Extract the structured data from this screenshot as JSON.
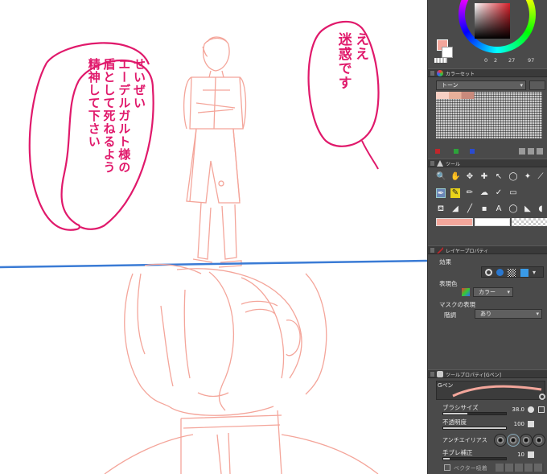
{
  "colors": {
    "accent_pink": "#e0196b",
    "sketch_pink": "#f4a59a",
    "guide_blue": "#3a7bd5",
    "main_color": "#f3a69b",
    "panel_bg": "#4a4a4a"
  },
  "canvas": {
    "bubble_left_text": "せいぜい\nエーデルガルト様の\n盾として死ねるよう\n精神して下さい",
    "bubble_right_text": "ええ\n迷惑です"
  },
  "color_wheel": {
    "values": [
      "0",
      "2",
      "27",
      "97"
    ]
  },
  "color_set": {
    "title": "カラーセット",
    "dropdown": "トーン"
  },
  "tool_panel": {
    "title": "ツール"
  },
  "layer_property": {
    "title": "レイヤープロパティ",
    "effect_label": "効果",
    "expression_color_label": "表現色",
    "expression_color_value": "カラー",
    "mask_label": "マスクの表現",
    "tone_label": "階調",
    "tone_value": "あり"
  },
  "tool_property": {
    "title": "ツールプロパティ[Gペン]",
    "brush_name": "Gペン",
    "brush_size_label": "ブラシサイズ",
    "brush_size_value": "38.0",
    "opacity_label": "不透明度",
    "opacity_value": "100",
    "opacity_fraction": 1.0,
    "antialias_label": "アンチエイリアス",
    "stabilization_label": "手ブレ補正",
    "stabilization_value": "10",
    "vector_label": "ベクター吸着"
  }
}
